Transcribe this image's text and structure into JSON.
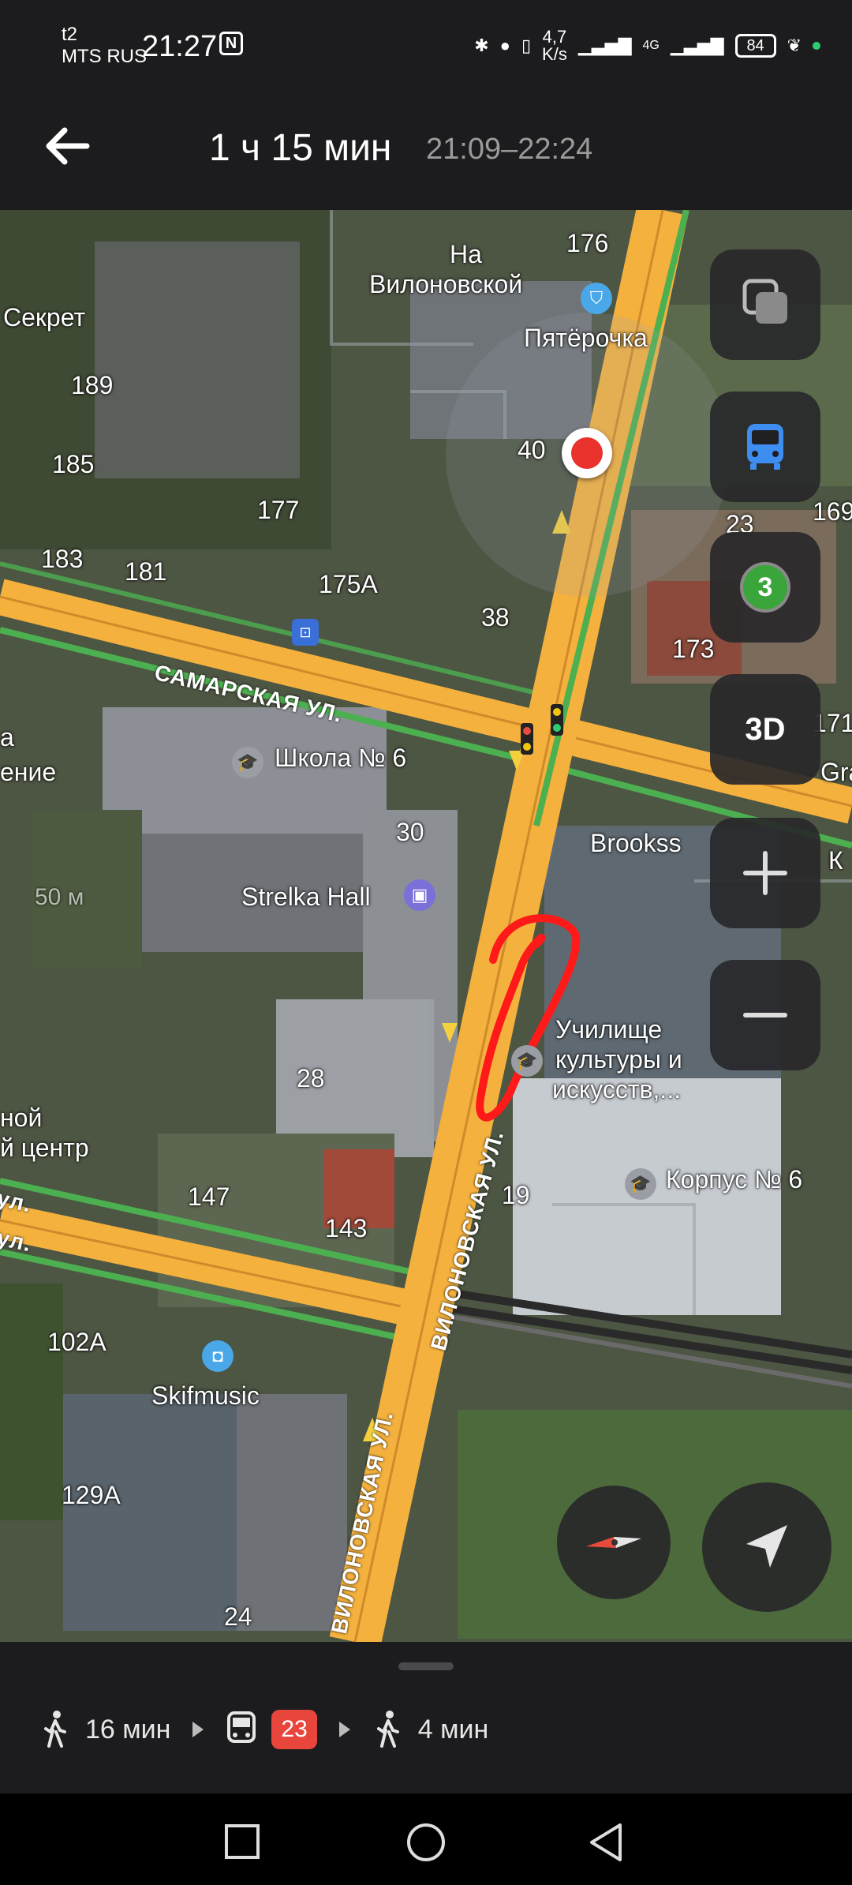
{
  "status_bar": {
    "carrier_line1": "t2",
    "carrier_line2": "MTS RUS",
    "time": "21:27",
    "nfc": "N",
    "speed_value": "4,7",
    "speed_unit": "K/s",
    "network": "4G",
    "battery": "84"
  },
  "header": {
    "duration": "1 ч 15 мин",
    "time_range": "21:09–22:24"
  },
  "map": {
    "labels": {
      "na_vilonovskoy_1": "На",
      "na_vilonovskoy_2": "Вилоновской",
      "n176": "176",
      "pyaterochka": "Пятёрочка",
      "sekret": "Секрет",
      "n189": "189",
      "n185": "185",
      "n183": "183",
      "n181": "181",
      "n177": "177",
      "n175a": "175А",
      "n40": "40",
      "n38": "38",
      "n23": "23",
      "n169": "169",
      "n173": "173",
      "n171": "171",
      "gra": "Gra",
      "samarskaya": "САМАРСКАЯ УЛ.",
      "shkola": "Школа № 6",
      "n30": "30",
      "strelka": "Strelka Hall",
      "brookss": "Brookss",
      "k": "К",
      "a": "а",
      "enie": "ение",
      "m50": "50 м",
      "uchilishe_1": "Училище",
      "uchilishe_2": "культуры и",
      "uchilishe_3": "искусств,...",
      "n28": "28",
      "noy": "ной",
      "centr": "й центр",
      "n147": "147",
      "n143": "143",
      "n19": "19",
      "korpus": "Корпус № 6",
      "ul1": "ул.",
      "ul2": "ул.",
      "vilonovskaya_1": "ВИЛОНОВСКАЯ УЛ.",
      "vilonovskaya_2": "ВИЛОНОВСКАЯ УЛ.",
      "n102a": "102А",
      "skifmusic": "Skifmusic",
      "n129a": "129А",
      "n24": "24",
      "bus_stop_count": "3"
    },
    "buttons": {
      "three_d": "3D"
    }
  },
  "route": {
    "walk1": "16 мин",
    "bus": "23",
    "walk2": "4 мин"
  },
  "colors": {
    "route_orange": "#f4b13e",
    "traffic_green": "#4caf50",
    "annotation_red": "#ff1a1a",
    "bus_badge": "#e8453c"
  }
}
